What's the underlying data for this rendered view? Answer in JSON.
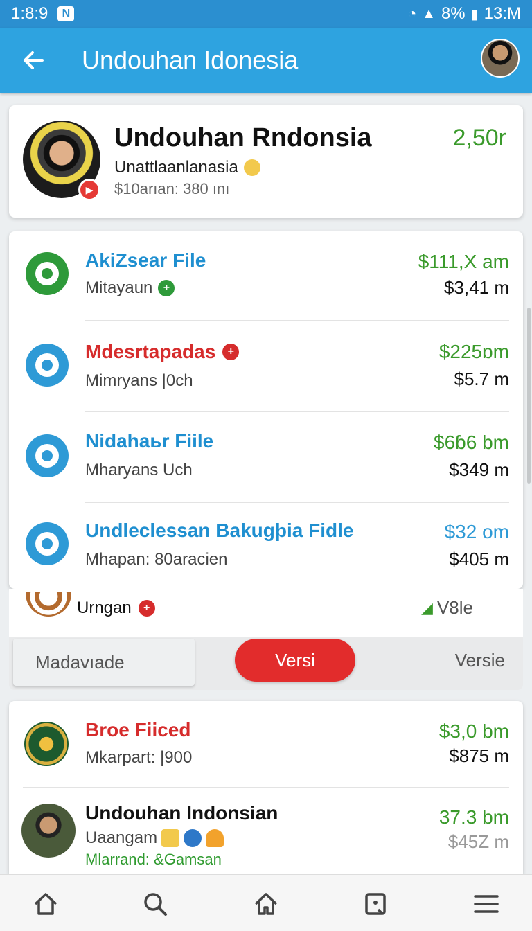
{
  "status_bar": {
    "time_left": "1:8:9",
    "battery": "8%",
    "time_right": "13:M"
  },
  "app_bar": {
    "title": "Undouhan Idonesia"
  },
  "profile": {
    "name": "Undouhan Rndonsia",
    "subtitle": "Unattlaanlanasia",
    "meta": "$10arıan: 380 ını",
    "value": "2,50r"
  },
  "files": [
    {
      "name": "AkiZsear File",
      "sub": "Mitayaun",
      "value1": "$111,X am",
      "value2": "$3,41 m",
      "name_color": "#1f8fd0",
      "value1_color": "#3a9a2b",
      "ring_color": "#2e9a3a",
      "badge": "plus-green"
    },
    {
      "name": "Mdesrtapadas",
      "sub": "Mimryans |0ch",
      "value1": "$225ɒm",
      "value2": "$5.7 m",
      "name_color": "#d62c2c",
      "value1_color": "#3a9a2b",
      "ring_color": "#2e9ad6",
      "badge": "plus-red"
    },
    {
      "name": "Nidahaьr Fiile",
      "sub": "Mharyans Uch",
      "value1": "$6ɓ6 bm",
      "value2": "$349 m",
      "name_color": "#1f8fd0",
      "value1_color": "#3a9a2b",
      "ring_color": "#2e9ad6",
      "badge": ""
    },
    {
      "name": "Undleclessan Bakugþia Fidle",
      "sub": "Mhapan:  80aracien",
      "value1": "$32 om",
      "value2": "$405 m",
      "name_color": "#1f8fd0",
      "value1_color": "#2e9ad6",
      "ring_color": "#2e9ad6",
      "badge": ""
    }
  ],
  "extra_row": {
    "label": "Urngan",
    "version": "V8le"
  },
  "tabs": {
    "tab1": "Madavıade",
    "tab2": "Versi",
    "tab3": "Versie"
  },
  "list2": [
    {
      "name": "Broe Fiiced",
      "sub": "Mkarpart: |900",
      "extra": "",
      "value1": "$3,0 bm",
      "value2": "$875 m",
      "name_color": "#d62c2c"
    },
    {
      "name": "Undouhan Indonsian",
      "sub": "Uaangam",
      "extra": "Mlarrand: &Gamsan",
      "value1": "37.3 bm",
      "value2": "$45Z m",
      "name_color": "#111111"
    }
  ],
  "icons": {
    "back": "arrow-left-icon",
    "nav": [
      "home-icon",
      "search-icon",
      "home-outline-icon",
      "bookmark-icon",
      "menu-icon"
    ]
  }
}
